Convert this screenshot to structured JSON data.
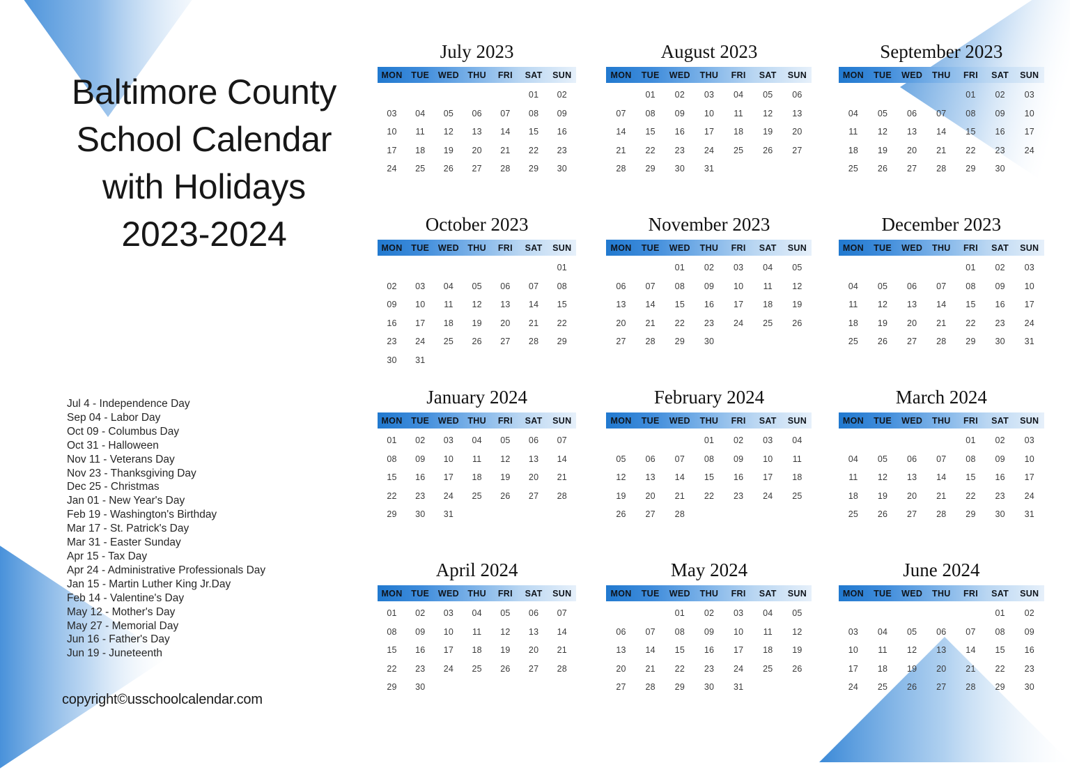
{
  "title": {
    "lines": [
      "Baltimore County",
      "School Calendar",
      "with Holidays",
      "2023-2024"
    ]
  },
  "copyright": "copyright©usschoolcalendar.com",
  "colors": {
    "header_gradient_start": "#2179cf",
    "header_gradient_end": "#e6f0fa",
    "deco_blue": "#2a7fd4",
    "day_text": "#3a3a3a",
    "title_text": "#171717"
  },
  "weekday_headers": [
    "MON",
    "TUE",
    "WED",
    "THU",
    "FRI",
    "SAT",
    "SUN"
  ],
  "holidays": [
    "Jul 4 - Independence Day",
    "Sep 04 - Labor Day",
    "Oct 09 - Columbus Day",
    "Oct 31 - Halloween",
    "Nov 11 - Veterans Day",
    "Nov 23 - Thanksgiving Day",
    "Dec 25 - Christmas",
    "Jan 01 - New Year's Day",
    "Feb 19 - Washington's Birthday",
    "Mar 17 - St. Patrick's Day",
    "Mar 31 - Easter Sunday",
    "Apr 15 - Tax Day",
    "Apr 24 - Administrative Professionals Day",
    "Jan 15 - Martin Luther King Jr.Day",
    "Feb 14 - Valentine's Day",
    "May 12 - Mother's Day",
    "May 27 - Memorial Day",
    "Jun 16 - Father's Day",
    "Jun 19 - Juneteenth"
  ],
  "months": [
    {
      "name": "July 2023",
      "lead_blanks": 5,
      "days": [
        "01",
        "02",
        "03",
        "04",
        "05",
        "06",
        "07",
        "08",
        "09",
        "10",
        "11",
        "12",
        "13",
        "14",
        "15",
        "16",
        "17",
        "18",
        "19",
        "20",
        "21",
        "22",
        "23",
        "24",
        "25",
        "26",
        "27",
        "28",
        "29",
        "30"
      ]
    },
    {
      "name": "August 2023",
      "lead_blanks": 1,
      "days": [
        "01",
        "02",
        "03",
        "04",
        "05",
        "06",
        "07",
        "08",
        "09",
        "10",
        "11",
        "12",
        "13",
        "14",
        "15",
        "16",
        "17",
        "18",
        "19",
        "20",
        "21",
        "22",
        "23",
        "24",
        "25",
        "26",
        "27",
        "28",
        "29",
        "30",
        "31"
      ]
    },
    {
      "name": "September 2023",
      "lead_blanks": 4,
      "days": [
        "01",
        "02",
        "03",
        "04",
        "05",
        "06",
        "07",
        "08",
        "09",
        "10",
        "11",
        "12",
        "13",
        "14",
        "15",
        "16",
        "17",
        "18",
        "19",
        "20",
        "21",
        "22",
        "23",
        "24",
        "25",
        "26",
        "27",
        "28",
        "29",
        "30"
      ]
    },
    {
      "name": "October 2023",
      "lead_blanks": 6,
      "days": [
        "01",
        "02",
        "03",
        "04",
        "05",
        "06",
        "07",
        "08",
        "09",
        "10",
        "11",
        "12",
        "13",
        "14",
        "15",
        "16",
        "17",
        "18",
        "19",
        "20",
        "21",
        "22",
        "23",
        "24",
        "25",
        "26",
        "27",
        "28",
        "29",
        "30",
        "31"
      ]
    },
    {
      "name": "November 2023",
      "lead_blanks": 2,
      "days": [
        "01",
        "02",
        "03",
        "04",
        "05",
        "06",
        "07",
        "08",
        "09",
        "10",
        "11",
        "12",
        "13",
        "14",
        "15",
        "16",
        "17",
        "18",
        "19",
        "20",
        "21",
        "22",
        "23",
        "24",
        "25",
        "26",
        "27",
        "28",
        "29",
        "30"
      ]
    },
    {
      "name": "December 2023",
      "lead_blanks": 4,
      "days": [
        "01",
        "02",
        "03",
        "04",
        "05",
        "06",
        "07",
        "08",
        "09",
        "10",
        "11",
        "12",
        "13",
        "14",
        "15",
        "16",
        "17",
        "18",
        "19",
        "20",
        "21",
        "22",
        "23",
        "24",
        "25",
        "26",
        "27",
        "28",
        "29",
        "30",
        "31"
      ]
    },
    {
      "name": "January 2024",
      "lead_blanks": 0,
      "days": [
        "01",
        "02",
        "03",
        "04",
        "05",
        "06",
        "07",
        "08",
        "09",
        "10",
        "11",
        "12",
        "13",
        "14",
        "15",
        "16",
        "17",
        "18",
        "19",
        "20",
        "21",
        "22",
        "23",
        "24",
        "25",
        "26",
        "27",
        "28",
        "29",
        "30",
        "31"
      ]
    },
    {
      "name": "February 2024",
      "lead_blanks": 3,
      "days": [
        "01",
        "02",
        "03",
        "04",
        "05",
        "06",
        "07",
        "08",
        "09",
        "10",
        "11",
        "12",
        "13",
        "14",
        "15",
        "16",
        "17",
        "18",
        "19",
        "20",
        "21",
        "22",
        "23",
        "24",
        "25",
        "26",
        "27",
        "28"
      ]
    },
    {
      "name": "March 2024",
      "lead_blanks": 4,
      "days": [
        "01",
        "02",
        "03",
        "04",
        "05",
        "06",
        "07",
        "08",
        "09",
        "10",
        "11",
        "12",
        "13",
        "14",
        "15",
        "16",
        "17",
        "18",
        "19",
        "20",
        "21",
        "22",
        "23",
        "24",
        "25",
        "26",
        "27",
        "28",
        "29",
        "30",
        "31"
      ]
    },
    {
      "name": "April 2024",
      "lead_blanks": 0,
      "days": [
        "01",
        "02",
        "03",
        "04",
        "05",
        "06",
        "07",
        "08",
        "09",
        "10",
        "11",
        "12",
        "13",
        "14",
        "15",
        "16",
        "17",
        "18",
        "19",
        "20",
        "21",
        "22",
        "23",
        "24",
        "25",
        "26",
        "27",
        "28",
        "29",
        "30"
      ]
    },
    {
      "name": "May 2024",
      "lead_blanks": 2,
      "days": [
        "01",
        "02",
        "03",
        "04",
        "05",
        "06",
        "07",
        "08",
        "09",
        "10",
        "11",
        "12",
        "13",
        "14",
        "15",
        "16",
        "17",
        "18",
        "19",
        "20",
        "21",
        "22",
        "23",
        "24",
        "25",
        "26",
        "27",
        "28",
        "29",
        "30",
        "31"
      ]
    },
    {
      "name": "June 2024",
      "lead_blanks": 5,
      "days": [
        "01",
        "02",
        "03",
        "04",
        "05",
        "06",
        "07",
        "08",
        "09",
        "10",
        "11",
        "12",
        "13",
        "14",
        "15",
        "16",
        "17",
        "18",
        "19",
        "20",
        "21",
        "22",
        "23",
        "24",
        "25",
        "26",
        "27",
        "28",
        "29",
        "30"
      ]
    }
  ]
}
